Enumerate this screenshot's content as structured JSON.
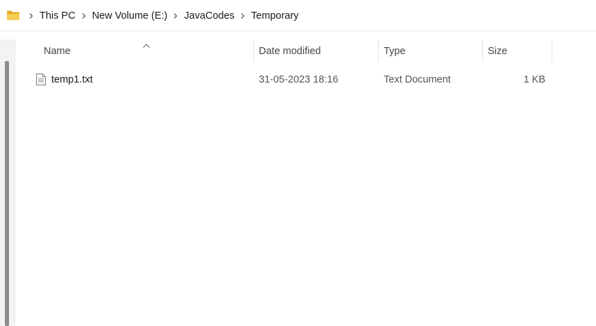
{
  "address_bar": {
    "icon": "folder-icon",
    "breadcrumbs": [
      "This PC",
      "New Volume (E:)",
      "JavaCodes",
      "Temporary"
    ]
  },
  "columns": {
    "name": "Name",
    "date_modified": "Date modified",
    "type": "Type",
    "size": "Size",
    "sort": "ascending"
  },
  "files": [
    {
      "icon": "text-file-icon",
      "name": "temp1.txt",
      "date_modified": "31-05-2023 18:16",
      "type": "Text Document",
      "size": "1 KB"
    }
  ],
  "colors": {
    "folder": "#f5c246",
    "scrollbar_thumb": "#8c8c8c"
  }
}
